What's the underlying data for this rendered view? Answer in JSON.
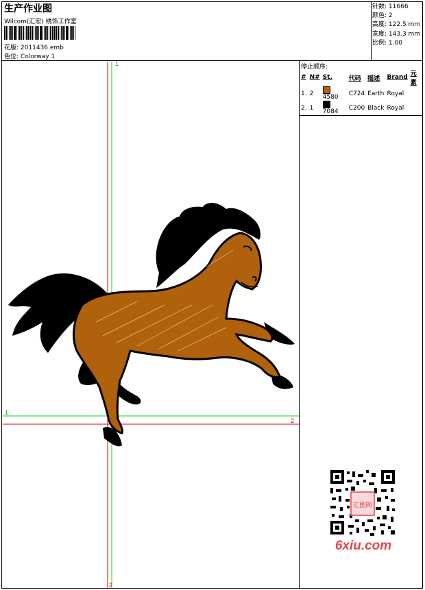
{
  "header": {
    "title": "生产作业图",
    "company": "Wilcom(汇宏) 绣饰工作室",
    "design_file_label": "花版:",
    "design_file": "2011436.emb",
    "colorway_label": "色位:",
    "colorway": "Colorway 1"
  },
  "stats": {
    "stitches_label": "针数:",
    "stitches": "11666",
    "colors_label": "颜色:",
    "colors": "2",
    "height_label": "高度:",
    "height": "122.5 mm",
    "width_label": "宽度:",
    "width": "143.3 mm",
    "scale_label": "比例:",
    "scale": "1.00"
  },
  "stop_sequence": {
    "title": "停止顺序:",
    "headers": [
      "#",
      "N#",
      "St.",
      "代码",
      "描述",
      "Brand",
      "元素"
    ],
    "rows": [
      {
        "idx": "1.",
        "n": "2",
        "color": "#b0610c",
        "st": "4580",
        "code": "C724",
        "desc": "Earth",
        "brand": "Royal"
      },
      {
        "idx": "2.",
        "n": "1",
        "color": "#000000",
        "st": "7084",
        "code": "C200",
        "desc": "Black",
        "brand": "Royal"
      }
    ]
  },
  "axes": {
    "v1_top": "1",
    "v2_bottom": "2",
    "h1_left": "1",
    "h2_right": "2"
  },
  "watermark": {
    "text": "6xiu.com",
    "stamp": "汇图网"
  },
  "colors": {
    "horse": "#b0610c",
    "black": "#000000",
    "green_guide": "#00dd00",
    "red_guide": "#dd0000",
    "watermark": "#e0464e"
  }
}
